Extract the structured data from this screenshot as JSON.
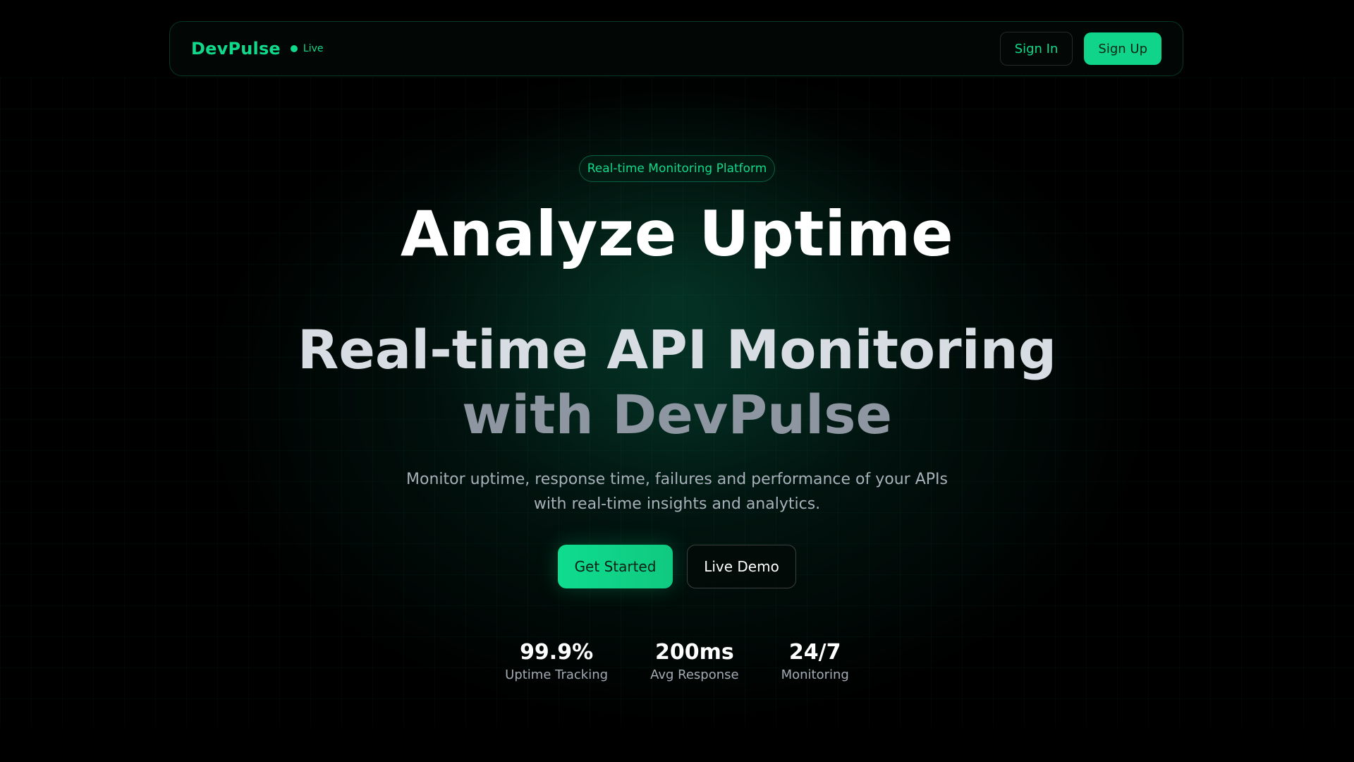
{
  "nav": {
    "brand": "DevPulse",
    "live_label": "Live",
    "sign_in": "Sign In",
    "sign_up": "Sign Up"
  },
  "hero": {
    "pill": "Real-time Monitoring Platform",
    "headline": "Analyze Uptime",
    "subheadline_line1": "Real-time API Monitoring",
    "subheadline_line2": "with DevPulse",
    "description_line1": "Monitor uptime, response time, failures and performance of your APIs",
    "description_line2": "with real-time insights and analytics.",
    "cta_primary": "Get Started",
    "cta_secondary": "Live Demo"
  },
  "stats": [
    {
      "value": "99.9%",
      "label": "Uptime Tracking"
    },
    {
      "value": "200ms",
      "label": "Avg Response"
    },
    {
      "value": "24/7",
      "label": "Monitoring"
    }
  ],
  "colors": {
    "accent": "#10d98b",
    "background": "#000000"
  }
}
